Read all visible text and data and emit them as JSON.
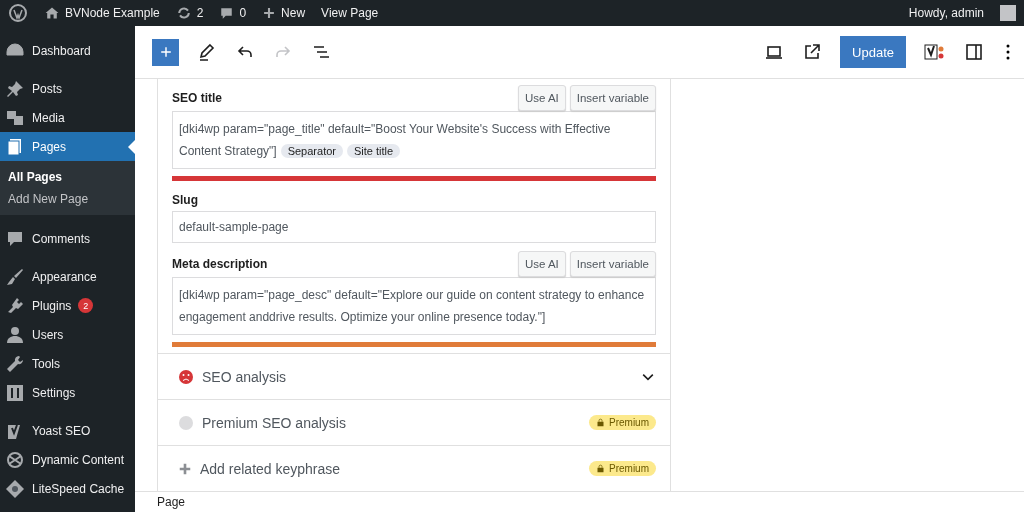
{
  "admin_bar": {
    "site": "BVNode Example",
    "updates": "2",
    "comments": "0",
    "new": "New",
    "view": "View Page",
    "greeting": "Howdy, admin"
  },
  "sidebar": {
    "items": [
      {
        "label": "Dashboard",
        "selected": false
      },
      {
        "label": "Posts",
        "selected": false
      },
      {
        "label": "Media",
        "selected": false
      },
      {
        "label": "Pages",
        "selected": true,
        "children": [
          {
            "label": "All Pages",
            "selected": true
          },
          {
            "label": "Add New Page",
            "selected": false
          }
        ]
      },
      {
        "label": "Comments",
        "selected": false
      },
      {
        "label": "Appearance",
        "selected": false
      },
      {
        "label": "Plugins",
        "selected": false,
        "badge": "2"
      },
      {
        "label": "Users",
        "selected": false
      },
      {
        "label": "Tools",
        "selected": false
      },
      {
        "label": "Settings",
        "selected": false
      },
      {
        "label": "Yoast SEO",
        "selected": false
      },
      {
        "label": "Dynamic Content",
        "selected": false
      },
      {
        "label": "LiteSpeed Cache",
        "selected": false
      }
    ]
  },
  "toolbar": {
    "update": "Update"
  },
  "fields": [
    {
      "kind": "rich",
      "label": "SEO title",
      "buttons": [
        "Use AI",
        "Insert variable"
      ],
      "value": "[dki4wp param=\"page_title\" default=\"Boost Your Website's Success with Effective Content Strategy\"]",
      "chips": [
        "Separator",
        "Site title"
      ],
      "color": "#d63638"
    },
    {
      "kind": "plain",
      "label": "Slug",
      "value": "default-sample-page"
    },
    {
      "kind": "rich",
      "label": "Meta description",
      "buttons": [
        "Use AI",
        "Insert variable"
      ],
      "value": "[dki4wp param=\"page_desc\" default=\"Explore our guide on content strategy to enhance engagement anddrive results. Optimize your online presence today.\"]",
      "color": "#e07b39"
    }
  ],
  "sections": [
    {
      "kind": "analysis",
      "label": "SEO analysis"
    },
    {
      "kind": "premium",
      "label": "Premium SEO analysis",
      "badge": "Premium"
    },
    {
      "kind": "add",
      "label": "Add related keyphrase",
      "badge": "Premium"
    }
  ],
  "footer": "Page"
}
